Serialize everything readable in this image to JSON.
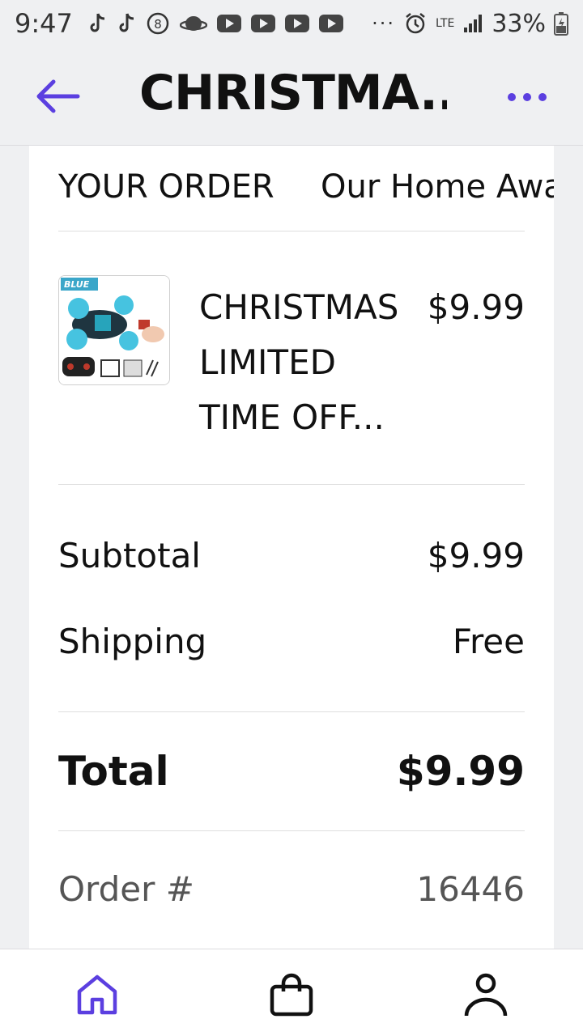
{
  "status_bar": {
    "time": "9:47",
    "network": "LTE",
    "battery": "33%"
  },
  "header": {
    "title": "CHRISTMA...",
    "back_icon": "arrow-left-icon",
    "more_icon": "more-horizontal-icon"
  },
  "tabs": [
    {
      "label": "YOUR ORDER"
    },
    {
      "label": "Our Home Awa"
    }
  ],
  "product": {
    "name": "CHRISTMAS LIMITED TIME OFF...",
    "price": "$9.99",
    "thumbnail_label": "BLUE"
  },
  "summary": {
    "subtotal_label": "Subtotal",
    "subtotal_value": "$9.99",
    "shipping_label": "Shipping",
    "shipping_value": "Free",
    "total_label": "Total",
    "total_value": "$9.99",
    "order_label": "Order #",
    "order_value": "16446"
  },
  "bottom_nav": [
    {
      "icon": "home-icon"
    },
    {
      "icon": "shopping-bag-icon"
    },
    {
      "icon": "profile-icon"
    }
  ],
  "colors": {
    "accent": "#5b3fe0",
    "background": "#eff0f2",
    "card": "#ffffff",
    "text": "#111111",
    "muted": "#555555"
  }
}
